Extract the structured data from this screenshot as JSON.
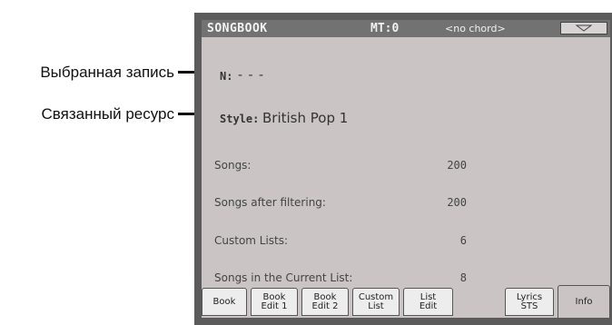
{
  "callouts": {
    "selected_entry": "Выбранная запись",
    "linked_resource": "Связанный ресурс"
  },
  "titlebar": {
    "title": "SONGBOOK",
    "mt": "MT:0",
    "chord": "<no chord>",
    "menu_icon": "triangle-down-icon"
  },
  "entry": {
    "label": "N:",
    "value": "- - -"
  },
  "style": {
    "label": "Style:",
    "value": "British Pop 1"
  },
  "stats": [
    {
      "label": "Songs:",
      "value": "200"
    },
    {
      "label": "Songs after filtering:",
      "value": "200"
    },
    {
      "label": "Custom Lists:",
      "value": "6"
    },
    {
      "label": "Songs in the Current List:",
      "value": "8"
    }
  ],
  "tabs": [
    {
      "label": "Book"
    },
    {
      "label": "Book\nEdit 1"
    },
    {
      "label": "Book\nEdit 2"
    },
    {
      "label": "Custom\nList"
    },
    {
      "label": "List\nEdit"
    },
    {
      "label": "Lyrics\nSTS"
    },
    {
      "label": "Info",
      "active": true
    }
  ]
}
